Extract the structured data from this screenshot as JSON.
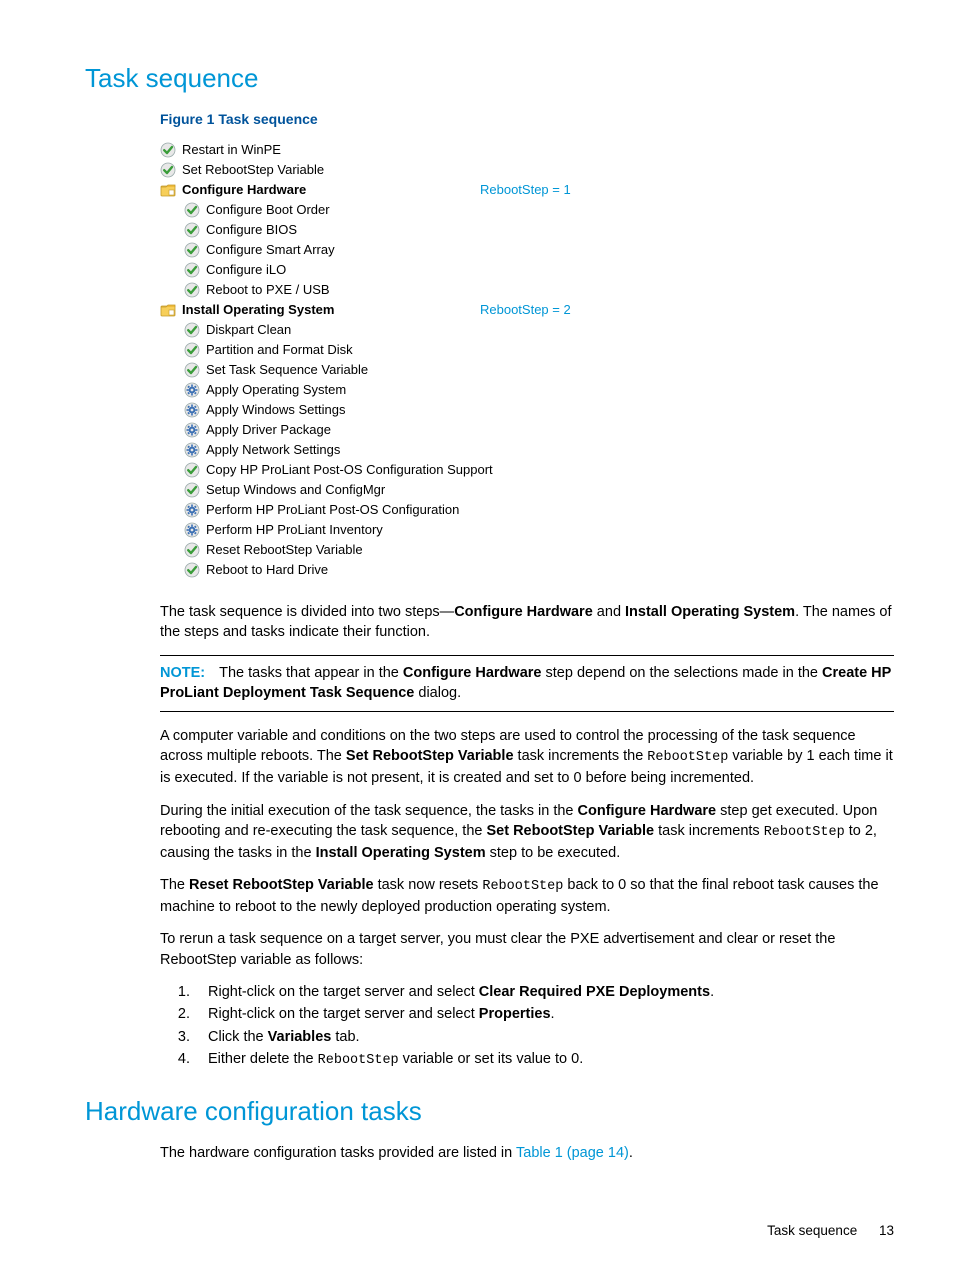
{
  "heading1": "Task sequence",
  "figure_caption": "Figure 1 Task sequence",
  "tree": {
    "items": [
      {
        "lvl": 0,
        "icon": "check",
        "label": "Restart in WinPE"
      },
      {
        "lvl": 0,
        "icon": "check",
        "label": "Set RebootStep Variable"
      },
      {
        "lvl": 0,
        "icon": "folder",
        "label": "Configure Hardware",
        "bold": true,
        "annot": "RebootStep = 1"
      },
      {
        "lvl": 1,
        "icon": "check",
        "label": "Configure Boot Order"
      },
      {
        "lvl": 1,
        "icon": "check",
        "label": "Configure BIOS"
      },
      {
        "lvl": 1,
        "icon": "check",
        "label": "Configure Smart Array"
      },
      {
        "lvl": 1,
        "icon": "check",
        "label": "Configure iLO"
      },
      {
        "lvl": 1,
        "icon": "check",
        "label": "Reboot to PXE / USB"
      },
      {
        "lvl": 0,
        "icon": "folder",
        "label": "Install Operating System",
        "bold": true,
        "annot": "RebootStep = 2"
      },
      {
        "lvl": 1,
        "icon": "check",
        "label": "Diskpart Clean"
      },
      {
        "lvl": 1,
        "icon": "check",
        "label": "Partition and Format Disk"
      },
      {
        "lvl": 1,
        "icon": "check",
        "label": "Set Task Sequence Variable"
      },
      {
        "lvl": 1,
        "icon": "gear",
        "label": "Apply Operating System"
      },
      {
        "lvl": 1,
        "icon": "gear",
        "label": "Apply Windows Settings"
      },
      {
        "lvl": 1,
        "icon": "gear",
        "label": "Apply Driver Package"
      },
      {
        "lvl": 1,
        "icon": "gear",
        "label": "Apply Network Settings"
      },
      {
        "lvl": 1,
        "icon": "check",
        "label": "Copy HP ProLiant Post-OS Configuration Support"
      },
      {
        "lvl": 1,
        "icon": "check",
        "label": "Setup Windows and ConfigMgr"
      },
      {
        "lvl": 1,
        "icon": "gear",
        "label": "Perform HP ProLiant Post-OS Configuration"
      },
      {
        "lvl": 1,
        "icon": "gear",
        "label": "Perform HP ProLiant Inventory"
      },
      {
        "lvl": 1,
        "icon": "check",
        "label": "Reset RebootStep Variable"
      },
      {
        "lvl": 1,
        "icon": "check",
        "label": "Reboot to Hard Drive"
      }
    ]
  },
  "p1_a": "The task sequence is divided into two steps—",
  "p1_b": "Configure Hardware",
  "p1_c": " and ",
  "p1_d": "Install Operating System",
  "p1_e": ". The names of the steps and tasks indicate their function.",
  "note_label": "NOTE:",
  "note_a": "The tasks that appear in the ",
  "note_b": "Configure Hardware",
  "note_c": " step depend on the selections made in the ",
  "note_d": "Create HP ProLiant Deployment Task Sequence",
  "note_e": " dialog.",
  "p2_a": "A computer variable and conditions on the two steps are used to control the processing of the task sequence across multiple reboots. The ",
  "p2_b": "Set RebootStep Variable",
  "p2_c": " task increments the ",
  "p2_d": "RebootStep",
  "p2_e": " variable by 1 each time it is executed. If the variable is not present, it is created and set to 0 before being incremented.",
  "p3_a": "During the initial execution of the task sequence, the tasks in the ",
  "p3_b": "Configure Hardware",
  "p3_c": " step get executed. Upon rebooting and re-executing the task sequence, the ",
  "p3_d": "Set RebootStep Variable",
  "p3_e": " task increments ",
  "p3_f": "RebootStep",
  "p3_g": " to 2, causing the tasks in the ",
  "p3_h": "Install Operating System",
  "p3_i": " step to be executed.",
  "p4_a": "The ",
  "p4_b": "Reset RebootStep Variable",
  "p4_c": " task now resets ",
  "p4_d": "RebootStep",
  "p4_e": " back to 0 so that the final reboot task causes the machine to reboot to the newly deployed production operating system.",
  "p5": "To rerun a task sequence on a target server, you must clear the PXE advertisement and clear or reset the RebootStep variable as follows:",
  "steps": {
    "s1_a": "Right-click on the target server and select ",
    "s1_b": "Clear Required PXE Deployments",
    "s1_c": ".",
    "s2_a": "Right-click on the target server and select ",
    "s2_b": "Properties",
    "s2_c": ".",
    "s3_a": "Click the ",
    "s3_b": "Variables",
    "s3_c": " tab.",
    "s4_a": "Either delete the ",
    "s4_b": "RebootStep",
    "s4_c": " variable or set its value to 0."
  },
  "heading2": "Hardware configuration tasks",
  "p6_a": "The hardware configuration tasks provided are listed in ",
  "p6_b": "Table 1 (page 14)",
  "p6_c": ".",
  "footer_label": "Task sequence",
  "footer_page": "13"
}
